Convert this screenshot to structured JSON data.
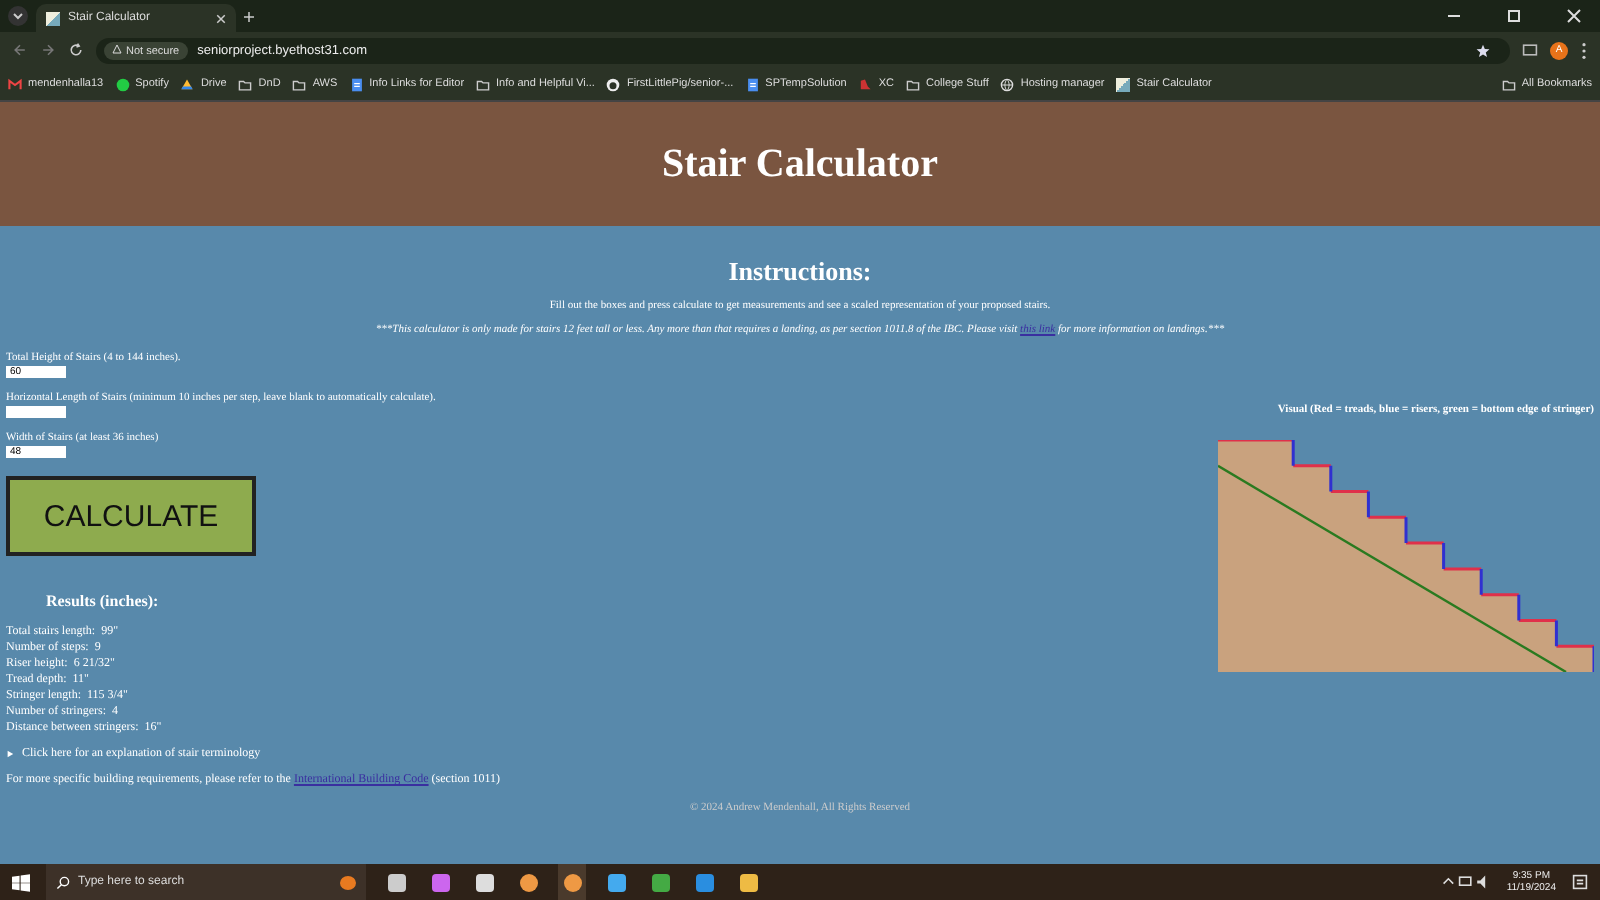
{
  "browser": {
    "tab_title": "Stair Calculator",
    "security": "Not secure",
    "url": "seniorproject.byethost31.com",
    "profile_initial": "A",
    "bookmarks": [
      {
        "label": "mendenhalla13",
        "kind": "mail"
      },
      {
        "label": "Spotify",
        "kind": "circle"
      },
      {
        "label": "Drive",
        "kind": "drive"
      },
      {
        "label": "DnD",
        "kind": "folder"
      },
      {
        "label": "AWS",
        "kind": "folder"
      },
      {
        "label": "Info Links for Editor",
        "kind": "doc"
      },
      {
        "label": "Info and Helpful Vi...",
        "kind": "folder"
      },
      {
        "label": "FirstLittlePig/senior-...",
        "kind": "github"
      },
      {
        "label": "SPTempSolution",
        "kind": "doc"
      },
      {
        "label": "XC",
        "kind": "site"
      },
      {
        "label": "College Stuff",
        "kind": "folder"
      },
      {
        "label": "Hosting manager",
        "kind": "globe"
      },
      {
        "label": "Stair Calculator",
        "kind": "page"
      }
    ],
    "all_bookmarks": "All Bookmarks"
  },
  "page": {
    "title": "Stair Calculator",
    "instructions_heading": "Instructions:",
    "instructions": "Fill out the boxes and press calculate to get measurements and see a scaled representation of your proposed stairs.",
    "notice_before": "***This calculator is only made for stairs 12 feet tall or less. Any more than that requires a landing, as per section 1011.8 of the IBC. Please visit",
    "notice_link": "this link",
    "notice_after": "for more information on landings.***",
    "fields": [
      {
        "label": "Total Height of Stairs (4 to 144 inches).",
        "value": "60"
      },
      {
        "label": "Horizontal Length of Stairs (minimum 10 inches per step, leave blank to automatically calculate)."
      },
      {
        "label": "Width of Stairs (at least 36 inches)",
        "value": "48"
      }
    ],
    "calculate_button": "CALCULATE",
    "results_heading": "Results (inches):",
    "results": [
      {
        "label": "Total stairs length:",
        "value": "99\""
      },
      {
        "label": "Number of steps:",
        "value": "9"
      },
      {
        "label": "Riser height:",
        "value": "6 21/32\""
      },
      {
        "label": "Tread depth:",
        "value": "11\""
      },
      {
        "label": "Stringer length:",
        "value": "115 3/4\""
      },
      {
        "label": "Number of stringers:",
        "value": "4"
      },
      {
        "label": "Distance between stringers:",
        "value": "16\""
      }
    ],
    "terminology": {
      "label": "Click here for an explanation of stair terminology",
      "expanded": false
    },
    "code_before": "For more specific building requirements, please refer to the",
    "code_link": "International Building Code",
    "code_after": "(section 1011)",
    "visual_caption": "Visual (Red = treads, blue = risers, green = bottom edge of stringer)",
    "footer": "© 2024 Andrew Mendenhall, All Rights Reserved"
  },
  "taskbar": {
    "search_placeholder": "Type here to search",
    "time": "9:35 PM",
    "date": "11/19/2024"
  }
}
